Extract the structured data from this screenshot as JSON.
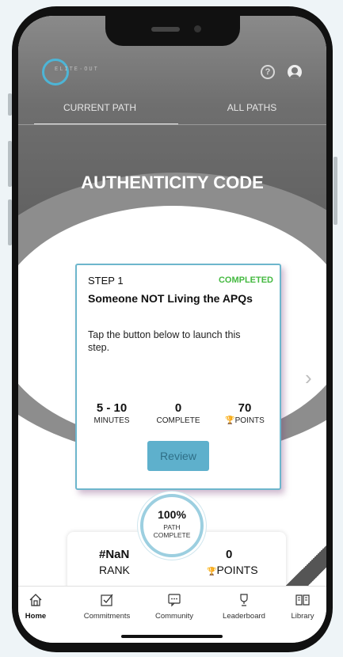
{
  "header": {
    "logo_text": "ELITE·OUT",
    "help_icon": "question-circle-icon",
    "profile_icon": "user-circle-icon"
  },
  "tabs": [
    {
      "label": "CURRENT PATH",
      "active": true
    },
    {
      "label": "ALL PATHS",
      "active": false
    }
  ],
  "path": {
    "title": "AUTHENTICITY CODE"
  },
  "step_card": {
    "step_label": "STEP 1",
    "status": "COMPLETED",
    "status_color": "#44b940",
    "title": "Someone NOT Living the APQs",
    "description": "Tap the button below to launch this step.",
    "stats": [
      {
        "value": "5 - 10",
        "label": "MINUTES"
      },
      {
        "value": "0",
        "label": "COMPLETE"
      },
      {
        "value": "70",
        "label": "POINTS",
        "icon": "trophy-icon"
      }
    ],
    "button_label": "Review"
  },
  "progress": {
    "percent": "100%",
    "label_line1": "PATH",
    "label_line2": "COMPLETE"
  },
  "summary": {
    "rank_value": "#NaN",
    "rank_label": "RANK",
    "points_value": "0",
    "points_label": "POINTS"
  },
  "bottom_nav": [
    {
      "label": "Home",
      "icon": "home-icon",
      "active": true
    },
    {
      "label": "Commitments",
      "icon": "checkbox-icon",
      "active": false
    },
    {
      "label": "Community",
      "icon": "chat-icon",
      "active": false
    },
    {
      "label": "Leaderboard",
      "icon": "trophy-icon",
      "active": false
    },
    {
      "label": "Library",
      "icon": "book-icon",
      "active": false
    }
  ],
  "colors": {
    "accent": "#5eb0cc",
    "trophy": "#e8a91c"
  }
}
